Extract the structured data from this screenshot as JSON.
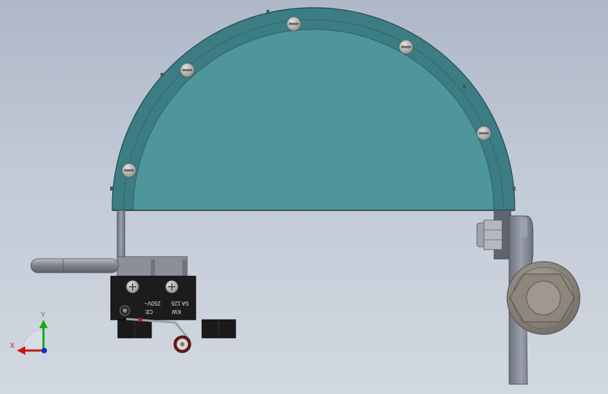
{
  "viewport": {
    "background_top": "#aeb8c7",
    "background_bottom": "#d2d8e1"
  },
  "model": {
    "cover_color": "#4f969b",
    "cover_rim_color": "#3b7d82",
    "metal_color": "#8a8f9a",
    "switch_body_color": "#1c1c1c",
    "roller_color": "#6b1a1a"
  },
  "switch_marking": {
    "brand": "KW",
    "cert": "CE",
    "rating_1": "5A 125",
    "rating_2": "250V~"
  },
  "triad": {
    "x_label": "X",
    "y_label": "Y",
    "x_color": "#cc1111",
    "y_color": "#11aa11",
    "z_color": "#1133cc"
  }
}
